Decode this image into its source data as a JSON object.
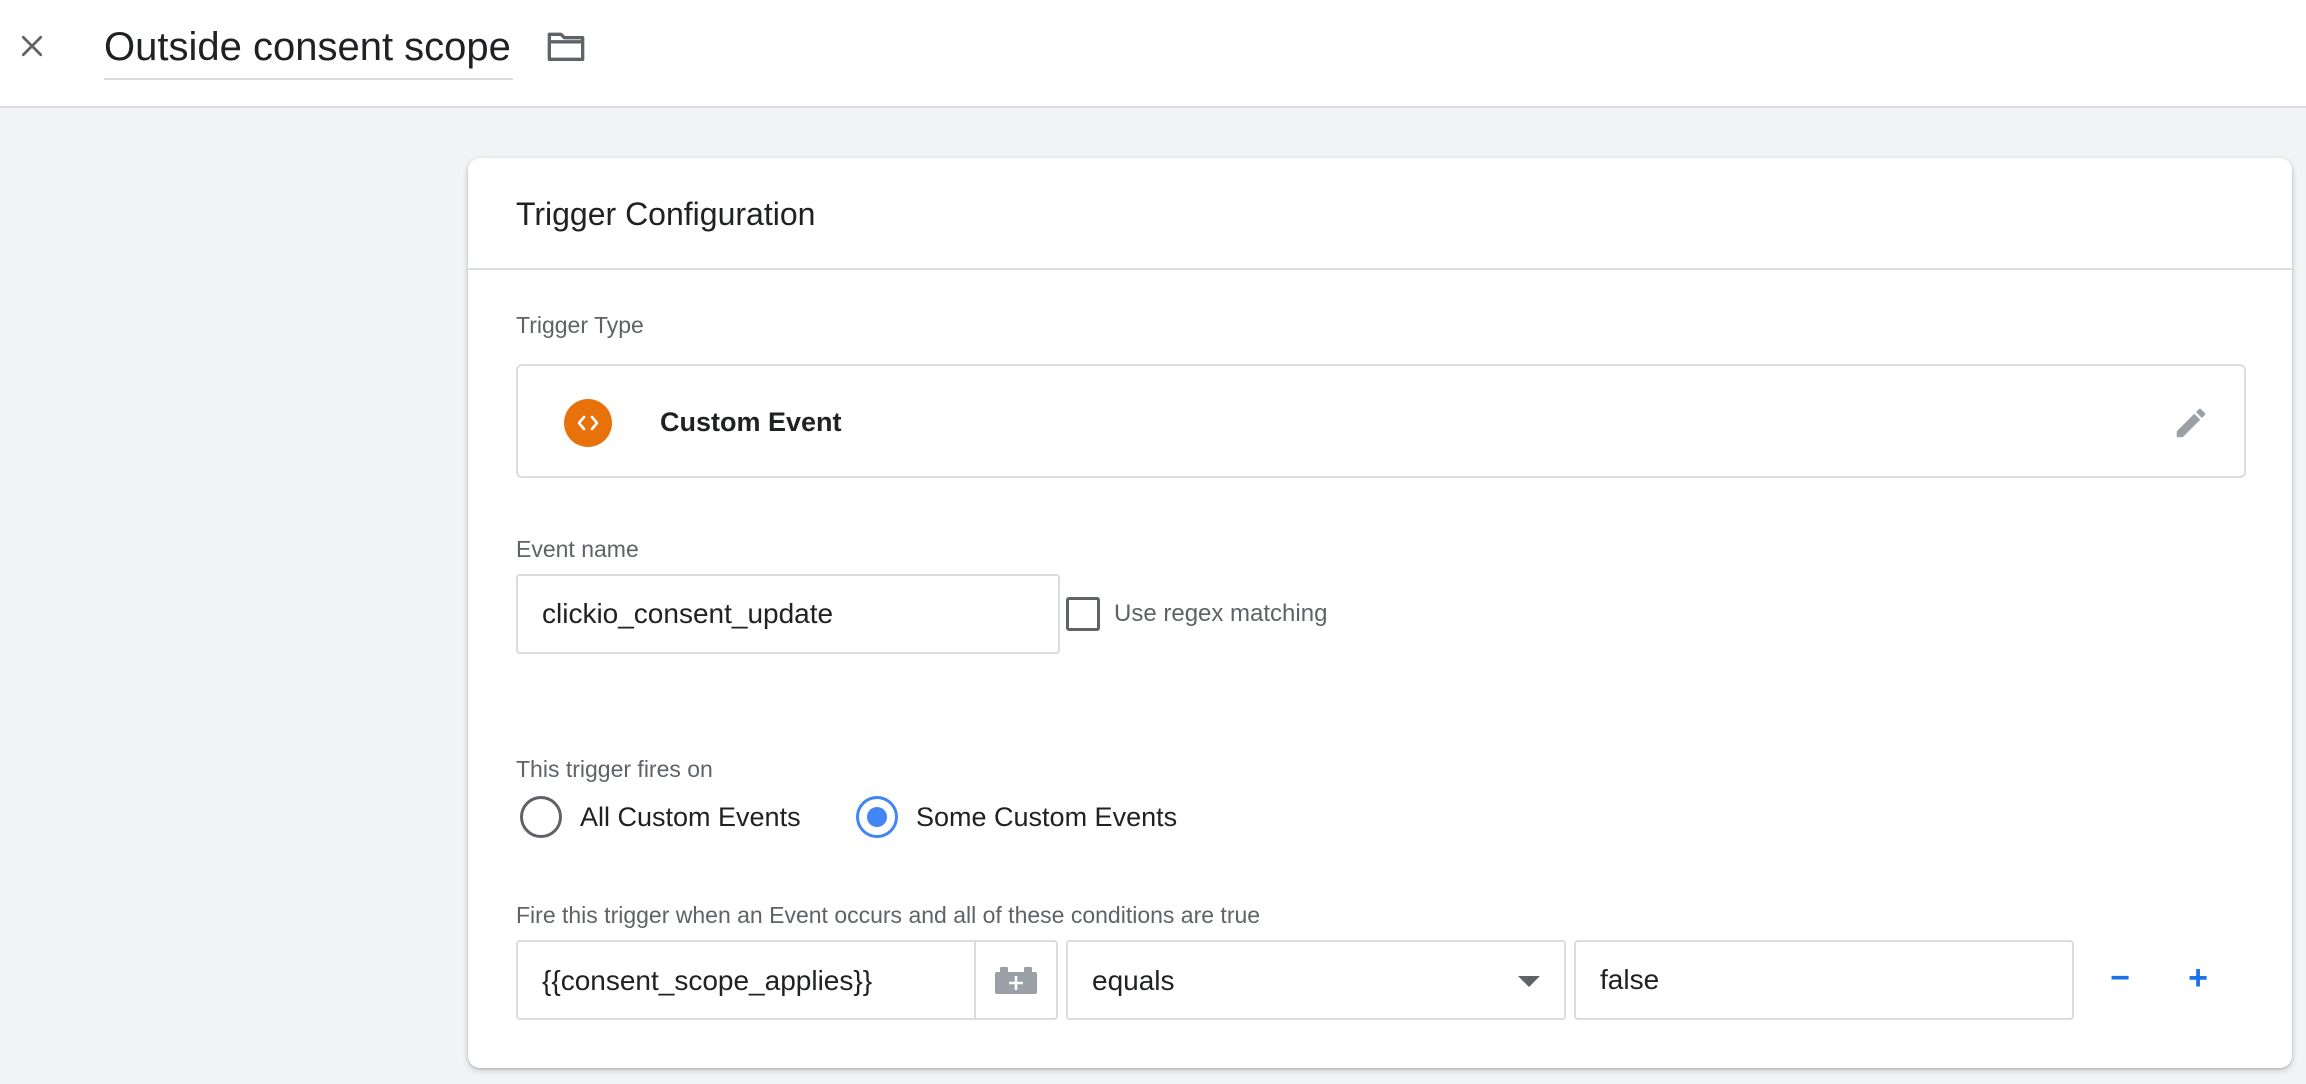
{
  "header": {
    "title": "Outside consent scope",
    "close_icon": "close-icon",
    "folder_icon": "folder-icon"
  },
  "card": {
    "title": "Trigger Configuration",
    "trigger_type_label": "Trigger Type",
    "trigger_type": {
      "name": "Custom Event",
      "icon": "code-brackets-icon",
      "icon_color": "#e8710a",
      "edit_icon": "pencil-icon"
    },
    "event_name": {
      "label": "Event name",
      "value": "clickio_consent_update"
    },
    "regex": {
      "label": "Use regex matching",
      "checked": false
    },
    "fires_on": {
      "label": "This trigger fires on",
      "options": [
        {
          "label": "All Custom Events",
          "selected": false
        },
        {
          "label": "Some Custom Events",
          "selected": true
        }
      ]
    },
    "conditions": {
      "label": "Fire this trigger when an Event occurs and all of these conditions are true",
      "variable": "{{consent_scope_applies}}",
      "operator": "equals",
      "value": "false",
      "remove_label": "−",
      "add_label": "+"
    }
  },
  "colors": {
    "accent": "#1a73e8",
    "radio_selected": "#4285f4",
    "border": "#dadce0",
    "background": "#f1f3f4"
  }
}
